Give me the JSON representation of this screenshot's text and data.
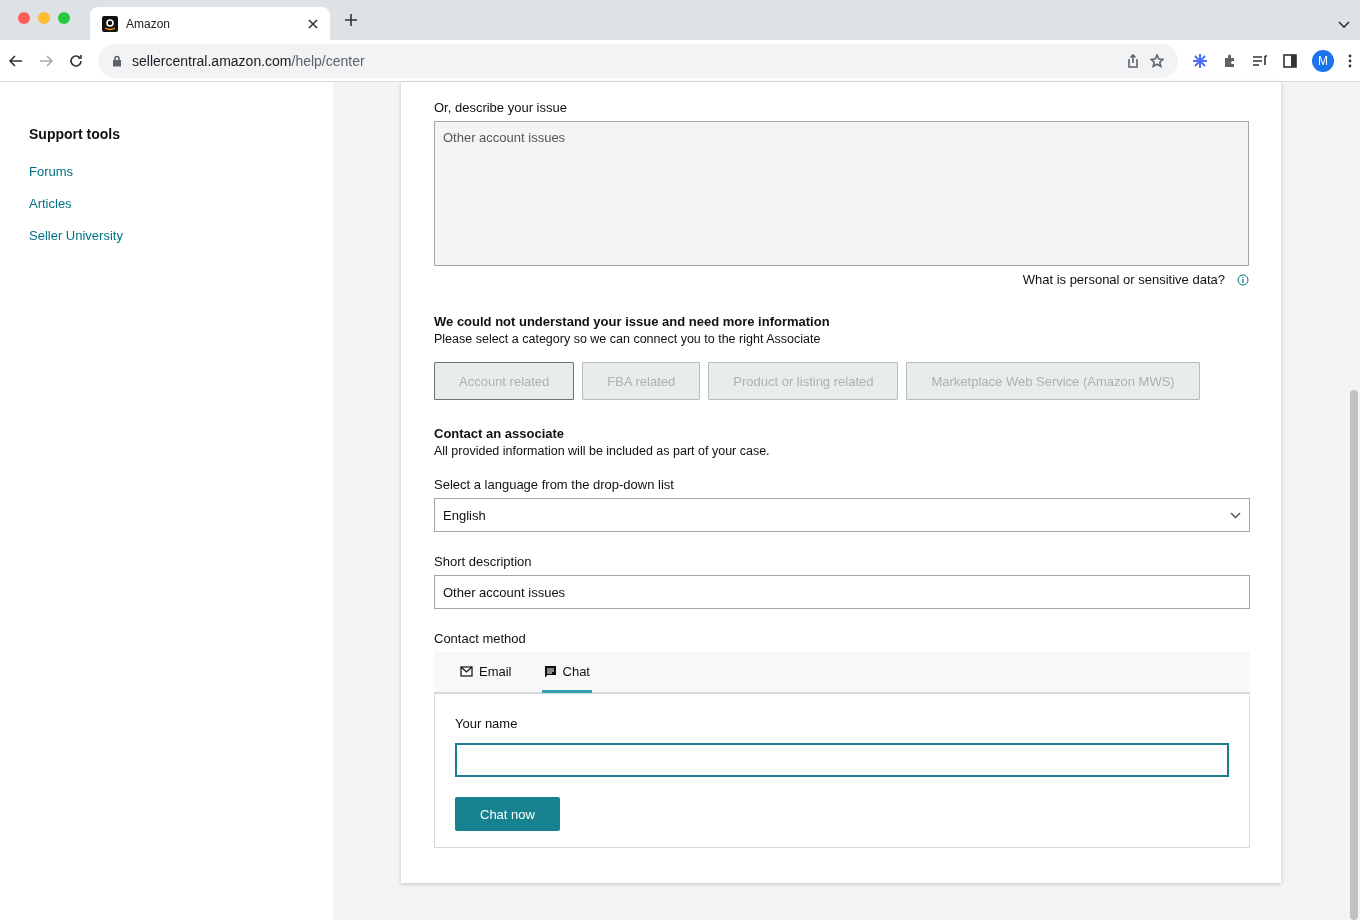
{
  "browser": {
    "tab": {
      "title": "Amazon"
    },
    "url": {
      "host": "sellercentral.amazon.com",
      "path": "/help/center"
    },
    "profile": "M"
  },
  "sidebar": {
    "title": "Support tools",
    "links": [
      "Forums",
      "Articles",
      "Seller University"
    ]
  },
  "describe": {
    "label": "Or, describe your issue",
    "value": "Other account issues",
    "disabled": true,
    "help_link": "What is personal or sensitive data?"
  },
  "category": {
    "title": "We could not understand your issue and need more information",
    "subtitle": "Please select a category so we can connect you to the right Associate",
    "options": [
      {
        "label": "Account related",
        "selected": true,
        "disabled": true
      },
      {
        "label": "FBA related",
        "selected": false,
        "disabled": true
      },
      {
        "label": "Product or listing related",
        "selected": false,
        "disabled": true
      },
      {
        "label": "Marketplace Web Service (Amazon MWS)",
        "selected": false,
        "disabled": true
      }
    ]
  },
  "contact": {
    "title": "Contact an associate",
    "subtitle": "All provided information will be included as part of your case.",
    "language": {
      "label": "Select a language from the drop-down list",
      "value": "English"
    },
    "short_description": {
      "label": "Short description",
      "value": "Other account issues"
    },
    "method": {
      "label": "Contact method",
      "tabs": [
        {
          "label": "Email",
          "kind": "email",
          "selected": false
        },
        {
          "label": "Chat",
          "kind": "chat",
          "selected": true
        }
      ]
    },
    "name_field": {
      "label": "Your name",
      "focused": true
    },
    "submit": "Chat now"
  }
}
